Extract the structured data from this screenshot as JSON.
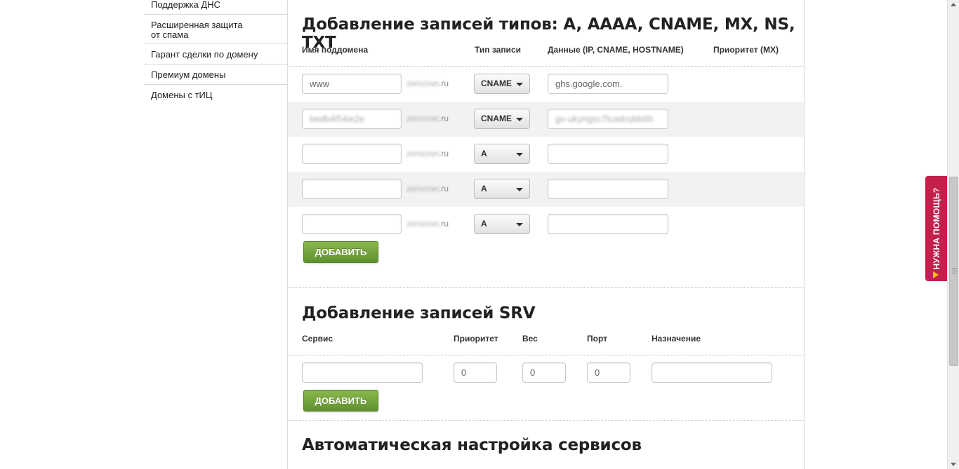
{
  "sidebar": {
    "items": [
      {
        "label": "Поддержка ДНС"
      },
      {
        "label": "Расширенная защита\nот спама"
      },
      {
        "label": "Гарант сделки по домену"
      },
      {
        "label": "Премиум домены"
      },
      {
        "label": "Домены с тИЦ"
      }
    ]
  },
  "records": {
    "title": "Добавление записей типов: A, AAAA, CNAME, MX, NS, TXT",
    "columns": {
      "subdomain": "Имя поддомена",
      "type": "Тип записи",
      "data": "Данные (IP, CNAME, HOSTNAME)",
      "priority": "Приоритет (MX)"
    },
    "zone_suffix": ".ru",
    "zone_blurred": "zerocner",
    "rows": [
      {
        "subdomain": "www",
        "type": "CNAME",
        "data": "ghs.google.com."
      },
      {
        "subdomain": "bedb4l54ie2e",
        "type": "CNAME",
        "data": "gv-ukyngsc7lcadcubb6h"
      },
      {
        "subdomain": "",
        "type": "A",
        "data": ""
      },
      {
        "subdomain": "",
        "type": "A",
        "data": ""
      },
      {
        "subdomain": "",
        "type": "A",
        "data": ""
      }
    ],
    "add_label": "ДОБАВИТЬ"
  },
  "srv": {
    "title": "Добавление записей SRV",
    "columns": {
      "service": "Сервис",
      "priority": "Приоритет",
      "weight": "Вес",
      "port": "Порт",
      "target": "Назначение"
    },
    "values": {
      "service": "",
      "priority": "0",
      "weight": "0",
      "port": "0",
      "target": ""
    },
    "add_label": "ДОБАВИТЬ"
  },
  "auto": {
    "title": "Автоматическая настройка сервисов"
  },
  "help_tab": {
    "label": "НУЖНА ПОМОЩЬ?"
  },
  "colors": {
    "accent_green": "#6fa23a",
    "help_tab": "#c4204c"
  }
}
